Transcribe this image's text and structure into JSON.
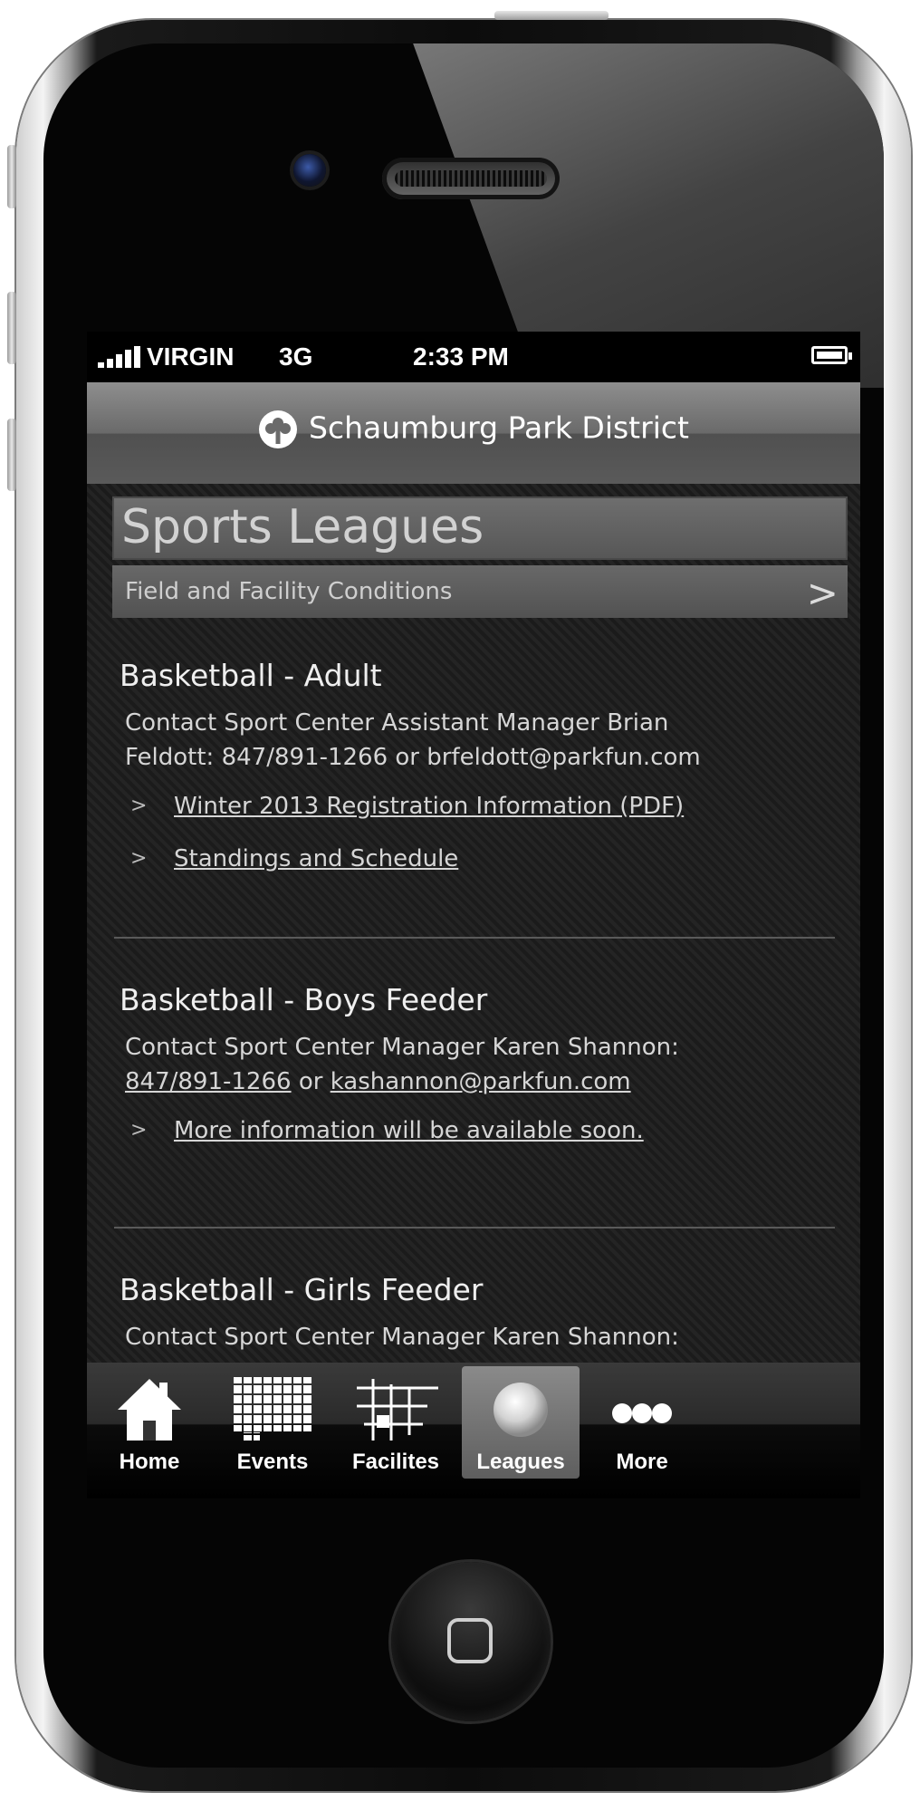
{
  "status_bar": {
    "carrier": "VIRGIN",
    "network": "3G",
    "time": "2:33 PM"
  },
  "header": {
    "title": "Schaumburg Park District"
  },
  "page": {
    "title": "Sports Leagues",
    "conditions_link": "Field and Facility Conditions"
  },
  "leagues": [
    {
      "name": "Basketball - Adult",
      "contact_line1": "Contact Sport Center Assistant Manager Brian",
      "contact_line2": "Feldott: 847/891-1266 or brfeldott@parkfun.com",
      "links": [
        "Winter 2013 Registration Information (PDF)",
        "Standings and Schedule"
      ]
    },
    {
      "name": "Basketball - Boys Feeder",
      "contact_line1": "Contact Sport Center Manager Karen Shannon:",
      "phone": "847/891-1266",
      "or": "or",
      "email": "kashannon@parkfun.com",
      "links": [
        "More information will be available soon."
      ]
    },
    {
      "name": "Basketball - Girls Feeder",
      "contact_line1": "Contact Sport Center Manager Karen Shannon:"
    }
  ],
  "link_arrow": ">",
  "tabs": [
    {
      "label": "Home",
      "icon": "house-icon"
    },
    {
      "label": "Events",
      "icon": "calendar-grid-icon"
    },
    {
      "label": "Facilites",
      "icon": "facility-map-icon"
    },
    {
      "label": "Leagues",
      "icon": "ball-icon",
      "active": true
    },
    {
      "label": "More",
      "icon": "more-dots-icon"
    }
  ]
}
